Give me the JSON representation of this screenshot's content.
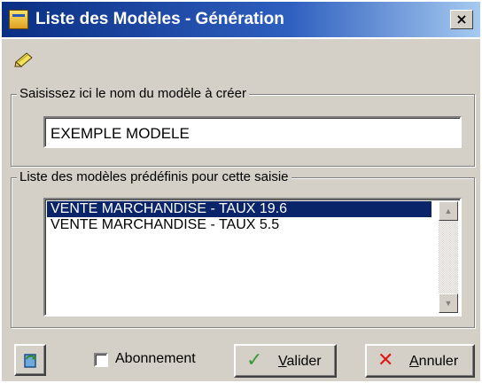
{
  "window": {
    "title": "Liste des Modèles - Génération",
    "close_glyph": "×"
  },
  "toolbar": {
    "edit_icon": "pencil-icon"
  },
  "name_group": {
    "label": "Saisissez ici le nom du modèle à créer",
    "value": "EXEMPLE MODELE"
  },
  "models_group": {
    "label": "Liste des modèles prédéfinis pour cette saisie",
    "items": [
      {
        "label": "VENTE MARCHANDISE - TAUX 19.6",
        "selected": true
      },
      {
        "label": "VENTE MARCHANDISE - TAUX 5.5",
        "selected": false
      }
    ]
  },
  "footer": {
    "refresh_icon": "refresh-icon",
    "subscription_label": "Abonnement",
    "subscription_checked": false,
    "validate": {
      "mnemonic": "V",
      "rest": "alider",
      "icon": "check-icon",
      "color": "#3a9a3a"
    },
    "cancel": {
      "mnemonic": "A",
      "rest": "nnuler",
      "icon": "x-icon",
      "color": "#e01818"
    }
  },
  "colors": {
    "titlebar_start": "#0a2f83",
    "titlebar_end": "#a6caf0",
    "selection": "#0a246a",
    "dialog_bg": "#d4d0c8"
  }
}
